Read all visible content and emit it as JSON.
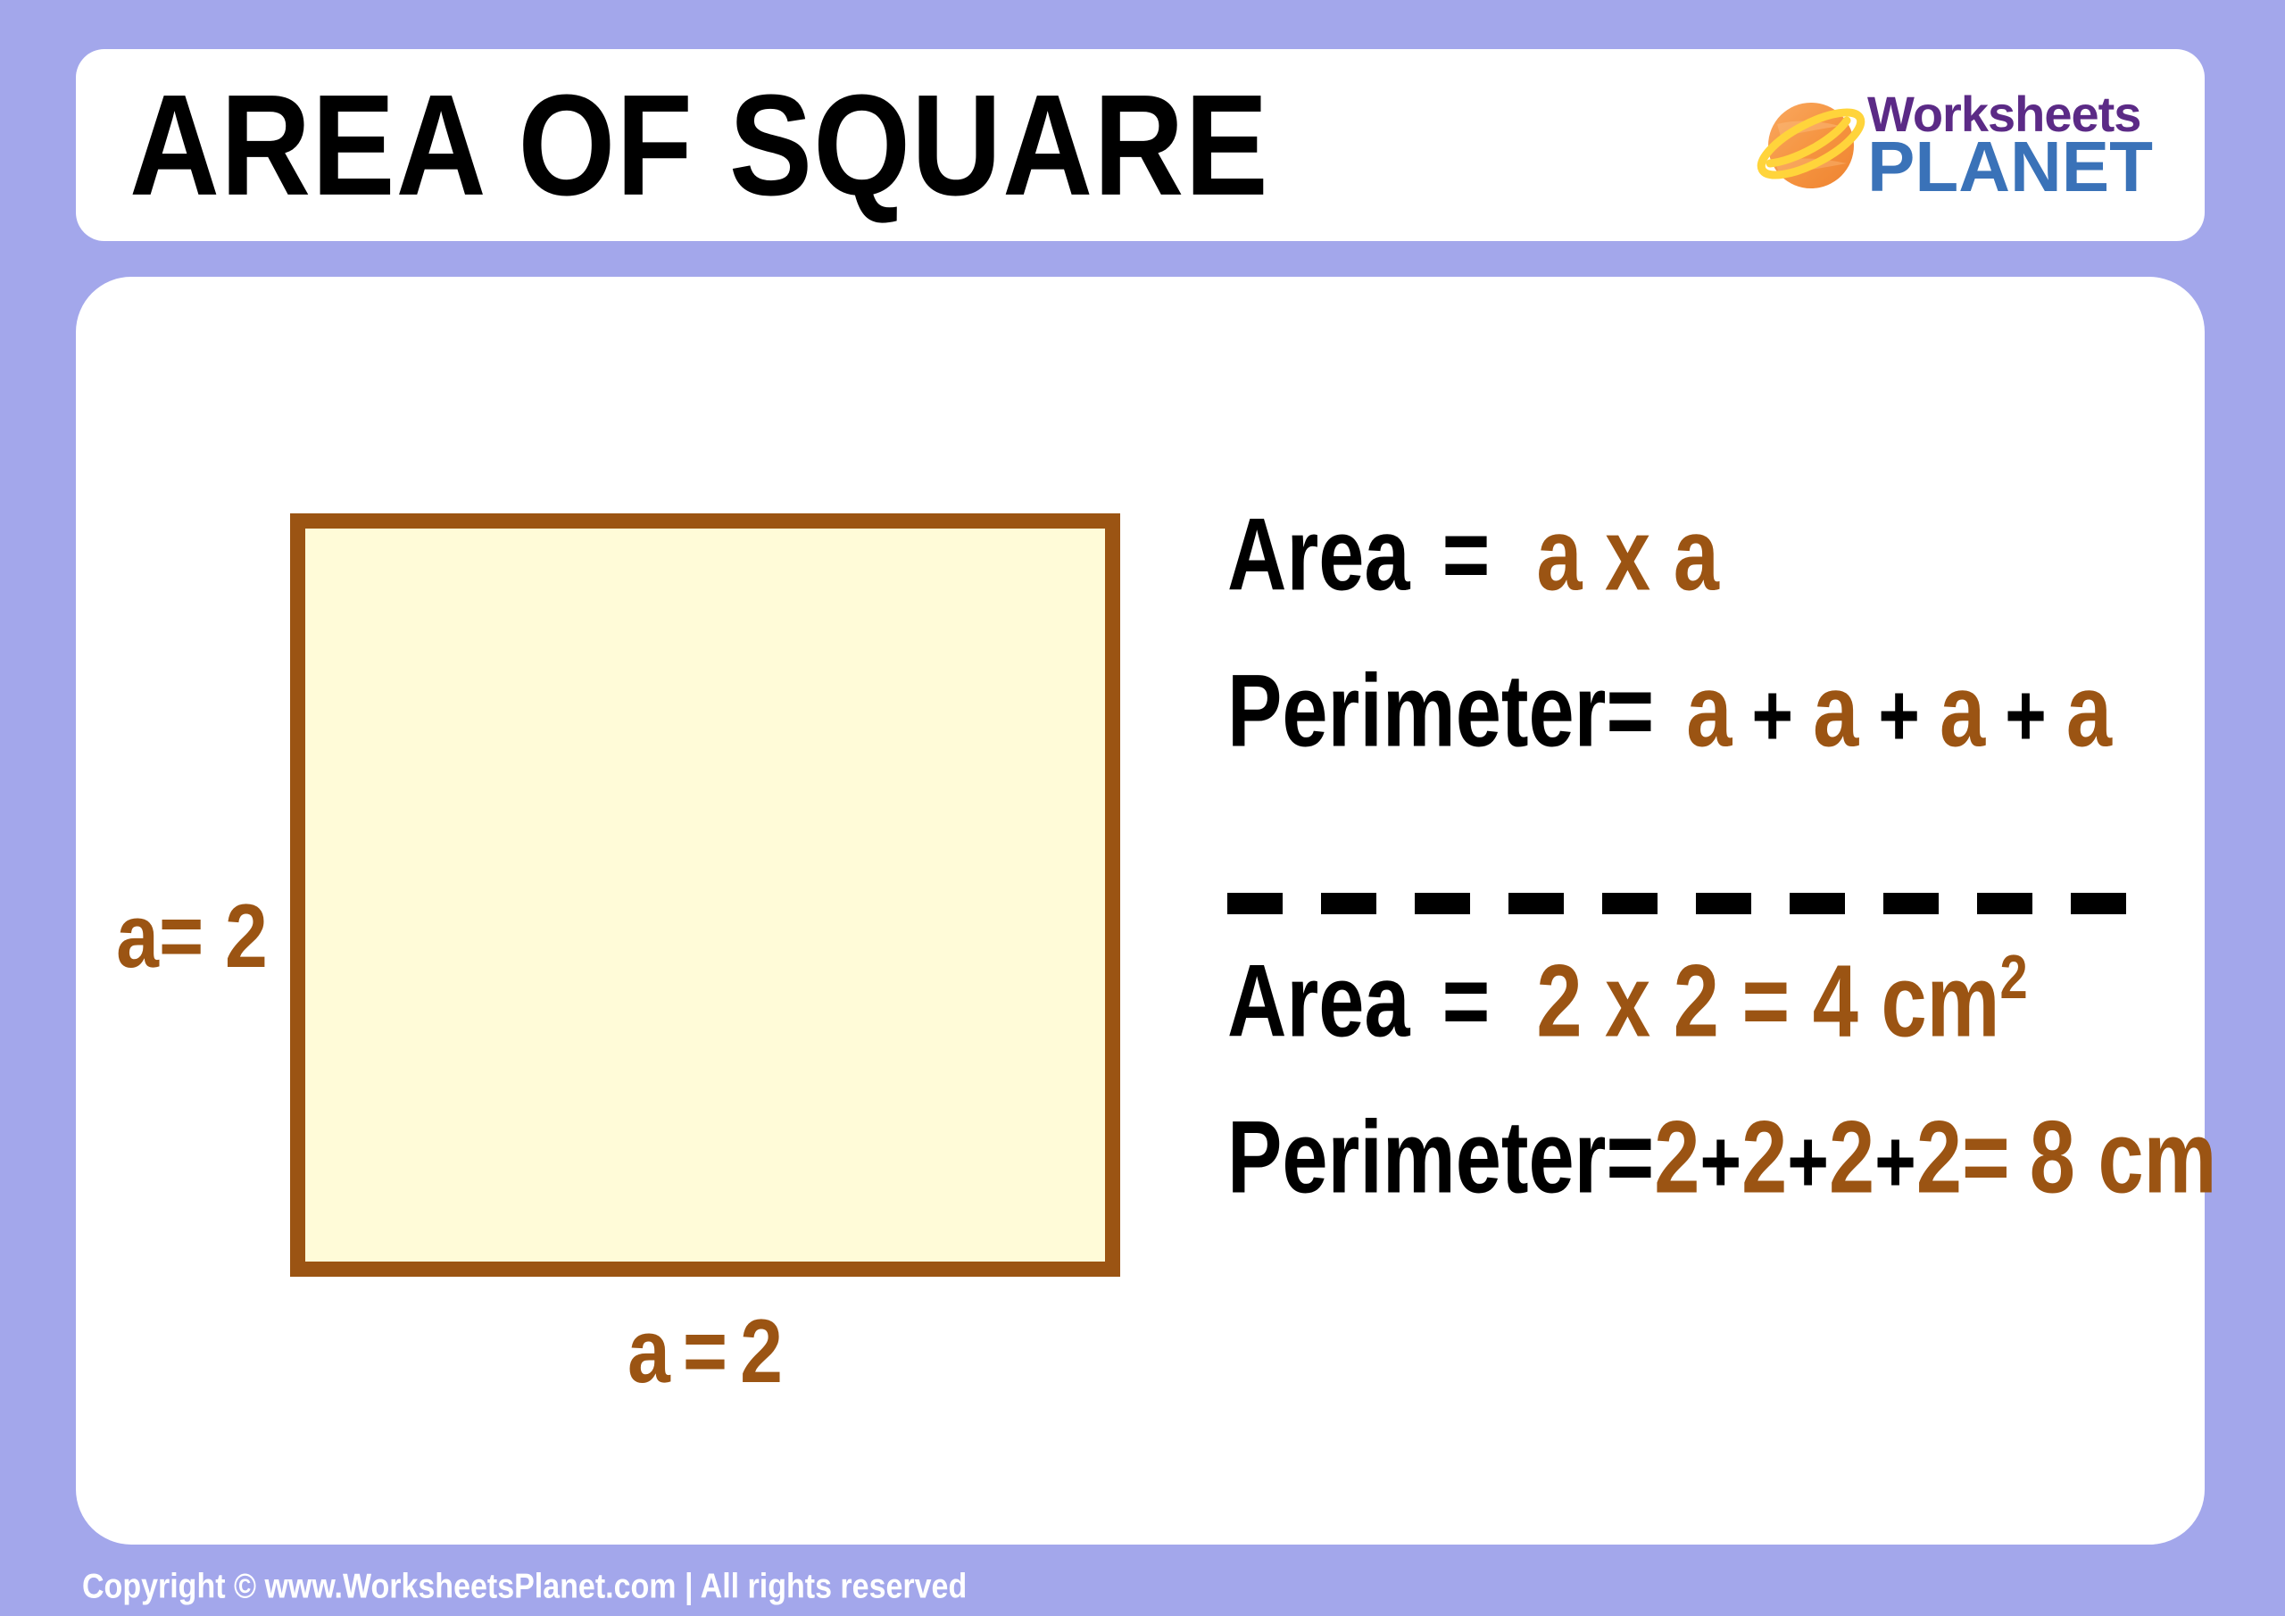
{
  "header": {
    "title": "AREA OF SQUARE",
    "logo": {
      "icon": "planet-icon",
      "line1": "Worksheets",
      "line2": "PLANET",
      "colors": {
        "planet_body": "#F5933F",
        "planet_ring": "#FFD43B",
        "worksheets_text": "#5B2A86",
        "planet_text": "#3A72B8"
      }
    }
  },
  "figure": {
    "shape": "square",
    "fill_color": "#FFFBD8",
    "border_color": "#9B5413",
    "side_label_left": "a= 2",
    "side_label_bottom_var": "a",
    "side_label_bottom_eq": "=",
    "side_label_bottom_val": "2"
  },
  "formulas": {
    "general": {
      "area": {
        "label": "Area",
        "equals": "=",
        "expression": "a x a"
      },
      "perimeter": {
        "label": "Perimeter",
        "equals": "=",
        "term1": "a",
        "op1": "+",
        "term2": "a",
        "op2": "+",
        "term3": "a",
        "op3": "+",
        "term4": "a"
      }
    },
    "worked": {
      "area": {
        "label": "Area",
        "equals": "=",
        "expression": "2 x 2 = 4 cm",
        "exponent": "2"
      },
      "perimeter": {
        "label": "Perimeter",
        "equals": "=",
        "term1": "2",
        "op1": "+",
        "term2": "2",
        "op2": "+",
        "term3": "2",
        "op3": "+",
        "term4": "2",
        "result_equals": "=",
        "result": "8 cm"
      }
    }
  },
  "divider": {
    "style": "dashed",
    "color": "#000000"
  },
  "footer": {
    "text": "Copyright © www.WorksheetsPlanet.com | All rights reserved"
  },
  "theme": {
    "background": "#A3A7EB",
    "card": "#FFFFFF",
    "accent_brown": "#9B5413",
    "cream": "#FFFBD8"
  }
}
